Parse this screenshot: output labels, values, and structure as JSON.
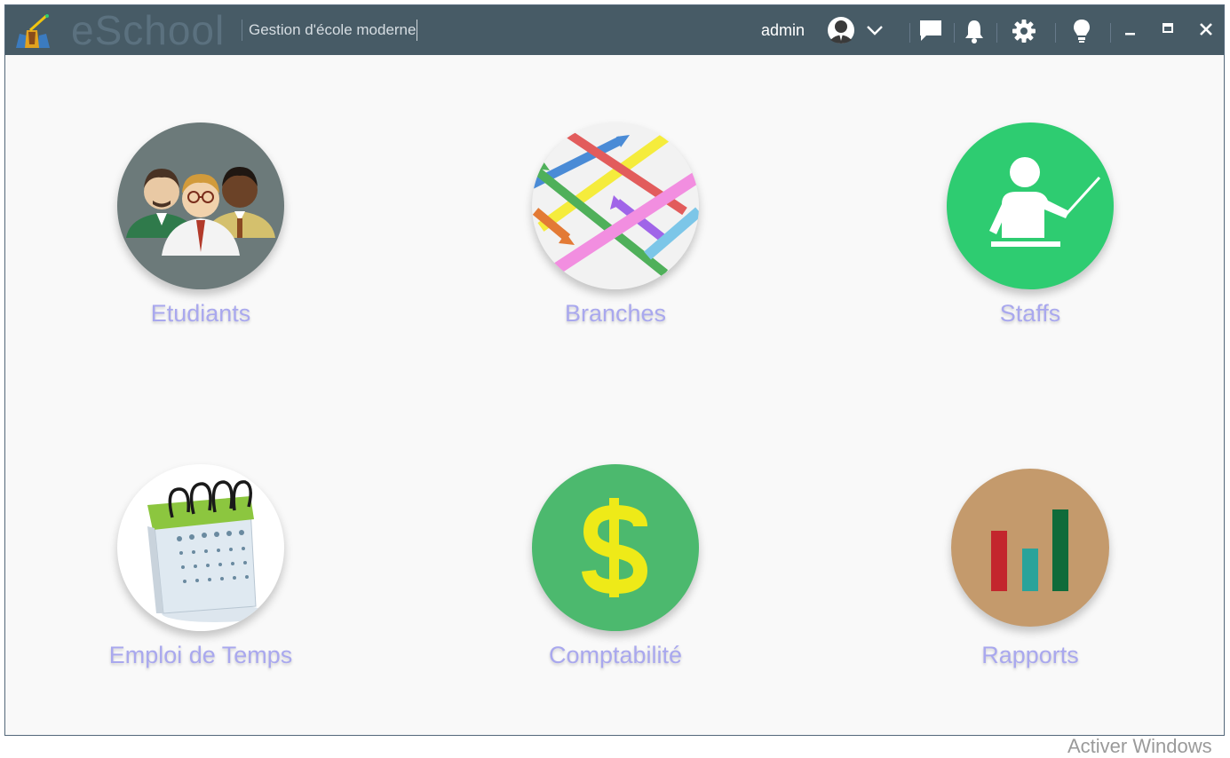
{
  "window": {
    "app_name": "eSchool",
    "subtitle": "Gestion d'école moderne",
    "username": "admin"
  },
  "titlebar_icons": [
    "user-avatar-icon",
    "chevron-down-icon",
    "chat-icon",
    "bell-icon",
    "gear-icon",
    "lightbulb-icon",
    "minimize-icon",
    "maximize-icon",
    "close-icon"
  ],
  "tiles": [
    {
      "label": "Etudiants",
      "icon": "students-icon",
      "bg": "#6c7a7a"
    },
    {
      "label": "Branches",
      "icon": "branches-icon",
      "bg": "#f2f2f2"
    },
    {
      "label": "Staffs",
      "icon": "teacher-icon",
      "bg": "#2ecc71"
    },
    {
      "label": "Emploi de Temps",
      "icon": "calendar-icon",
      "bg": "#ffffff"
    },
    {
      "label": "Comptabilité",
      "icon": "dollar-icon",
      "bg": "#4cb96e"
    },
    {
      "label": "Rapports",
      "icon": "bar-chart-icon",
      "bg": "#c49a6c"
    }
  ],
  "colors": {
    "titlebar": "#475b66",
    "label": "#a9a8ee",
    "background": "#f9f9f9"
  },
  "os_watermark": "Activer Windows"
}
